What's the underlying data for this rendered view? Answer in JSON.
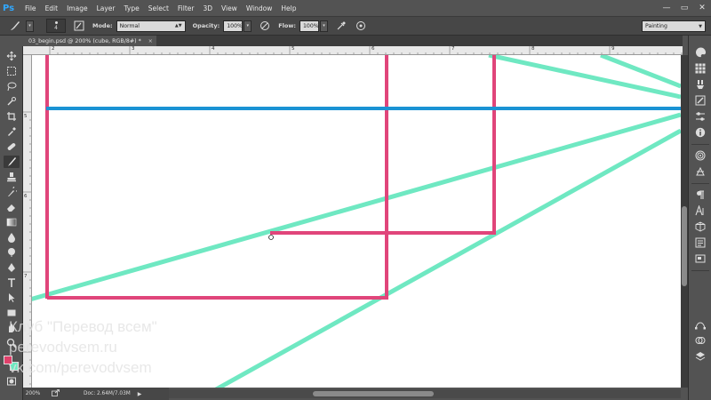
{
  "app": {
    "logo": "Ps",
    "menu": [
      "File",
      "Edit",
      "Image",
      "Layer",
      "Type",
      "Select",
      "Filter",
      "3D",
      "View",
      "Window",
      "Help"
    ]
  },
  "window_controls": [
    "—",
    "▭",
    "✕"
  ],
  "options": {
    "brush_size": "4",
    "mode_label": "Mode:",
    "mode_value": "Normal",
    "opacity_label": "Opacity:",
    "opacity_value": "100%",
    "flow_label": "Flow:",
    "flow_value": "100%",
    "workspace": "Painting"
  },
  "document_tab": {
    "title": "03_begin.psd @ 200% (cube, RGB/8#) *",
    "close": "×"
  },
  "ruler": {
    "top_labels": [
      "2",
      "3",
      "4",
      "5",
      "6",
      "7",
      "8",
      "9"
    ],
    "left_labels": [
      "5",
      "6",
      "7"
    ]
  },
  "canvas": {
    "colors": {
      "pink": "#e0457a",
      "blue": "#1a93d4",
      "mint": "#6fe8c2"
    }
  },
  "status": {
    "zoom": "200%",
    "doc": "Doc: 2.64M/7.03M",
    "arrow": "▶"
  },
  "tools": [
    "move-icon",
    "marquee-icon",
    "lasso-icon",
    "quick-select-icon",
    "crop-icon",
    "eyedropper-icon",
    "healing-icon",
    "brush-icon",
    "stamp-icon",
    "history-brush-icon",
    "eraser-icon",
    "gradient-icon",
    "blur-icon",
    "dodge-icon",
    "pen-icon",
    "type-icon",
    "path-select-icon",
    "rectangle-icon",
    "hand-icon",
    "zoom-icon"
  ],
  "watermark": {
    "line1": "Клуб \"Перевод всем\"",
    "line2": "perevodvsem.ru",
    "line3": "vk.com/perevodvsem"
  }
}
